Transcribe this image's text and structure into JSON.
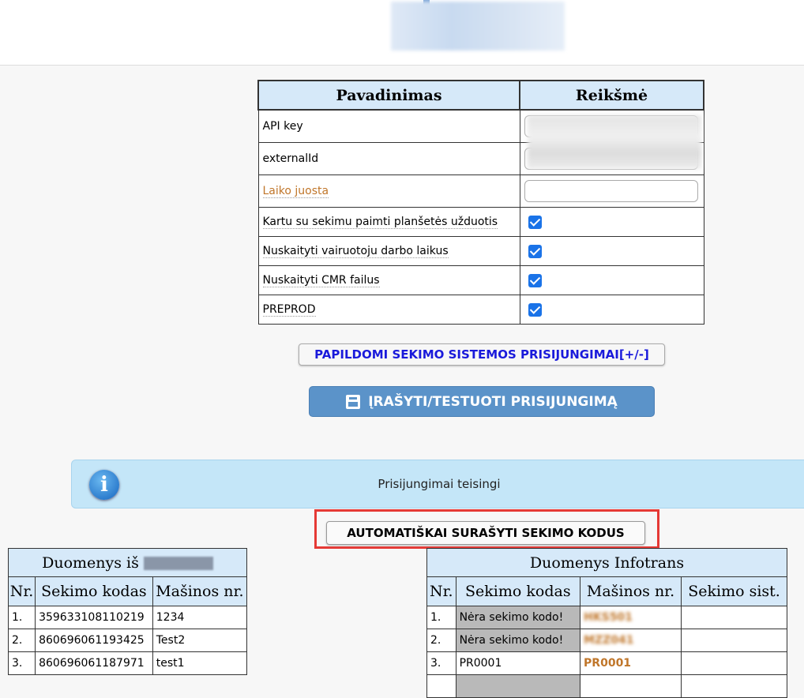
{
  "settings": {
    "col_name": "Pavadinimas",
    "col_value": "Reikšmė",
    "rows": [
      {
        "label": "API key"
      },
      {
        "label": "externalId"
      },
      {
        "label": "Laiko juosta"
      },
      {
        "label": "Kartu su sekimu paimti planšetės užduotis",
        "checked": true
      },
      {
        "label": "Nuskaityti vairuotoju darbo laikus",
        "checked": true
      },
      {
        "label": "Nuskaityti CMR failus",
        "checked": true
      },
      {
        "label": "PREPROD",
        "checked": true
      }
    ]
  },
  "buttons": {
    "extra_connections": "PAPILDOMI SEKIMO SISTEMOS PRISIJUNGIMAI[+/-]",
    "save_test": "ĮRAŠYTI/TESTUOTI PRISIJUNGIMĄ",
    "auto_codes": "AUTOMATIŠKAI SURAŠYTI SEKIMO KODUS"
  },
  "info": {
    "icon": "info-icon",
    "message": "Prisijungimai teisingi"
  },
  "left_table": {
    "caption": "Duomenys iš",
    "headers": [
      "Nr.",
      "Sekimo kodas",
      "Mašinos nr."
    ],
    "rows": [
      [
        "1.",
        "359633108110219",
        "1234"
      ],
      [
        "2.",
        "860696061193425",
        "Test2"
      ],
      [
        "3.",
        "860696061187971",
        "test1"
      ]
    ]
  },
  "right_table": {
    "caption": "Duomenys Infotrans",
    "headers": [
      "Nr.",
      "Sekimo kodas",
      "Mašinos nr.",
      "Sekimo sist."
    ],
    "rows": [
      [
        "1.",
        "Nėra sekimo kodo!",
        "HKS501",
        ""
      ],
      [
        "2.",
        "Nėra sekimo kodo!",
        "MZZ041",
        ""
      ],
      [
        "3.",
        "PR0001",
        "PR0001",
        ""
      ]
    ]
  },
  "colors": {
    "accent": "#5b93c9",
    "header_bg": "#d6e9f9",
    "highlight": "#e53935",
    "plate": "#c0762a"
  }
}
